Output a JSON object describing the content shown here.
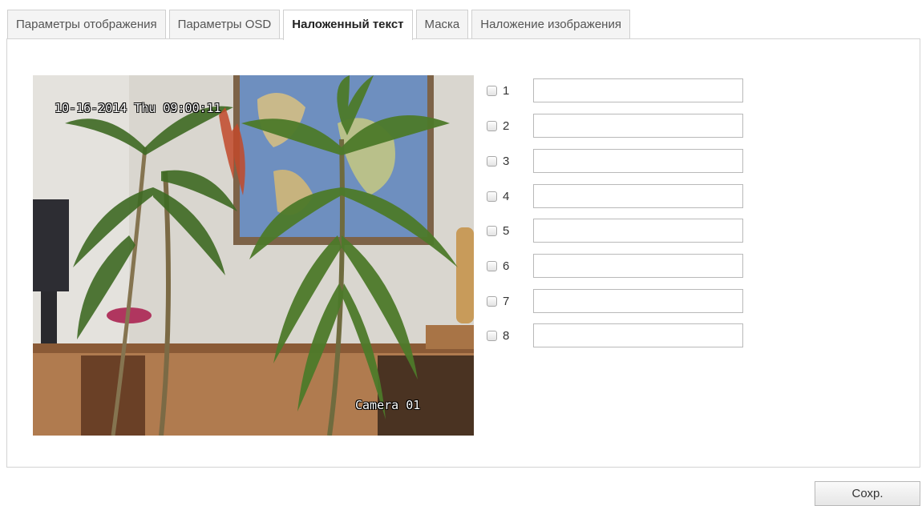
{
  "tabs": [
    {
      "label": "Параметры отображения",
      "active": false
    },
    {
      "label": "Параметры OSD",
      "active": false
    },
    {
      "label": "Наложенный текст",
      "active": true
    },
    {
      "label": "Маска",
      "active": false
    },
    {
      "label": "Наложение изображения",
      "active": false
    }
  ],
  "preview": {
    "datetime": "10-16-2014 Thu 09:00:11",
    "camera_name": "Camera 01"
  },
  "overlays": [
    {
      "number": "1",
      "checked": false,
      "value": ""
    },
    {
      "number": "2",
      "checked": false,
      "value": ""
    },
    {
      "number": "3",
      "checked": false,
      "value": ""
    },
    {
      "number": "4",
      "checked": false,
      "value": ""
    },
    {
      "number": "5",
      "checked": false,
      "value": ""
    },
    {
      "number": "6",
      "checked": false,
      "value": ""
    },
    {
      "number": "7",
      "checked": false,
      "value": ""
    },
    {
      "number": "8",
      "checked": false,
      "value": ""
    }
  ],
  "save_label": "Сохр."
}
